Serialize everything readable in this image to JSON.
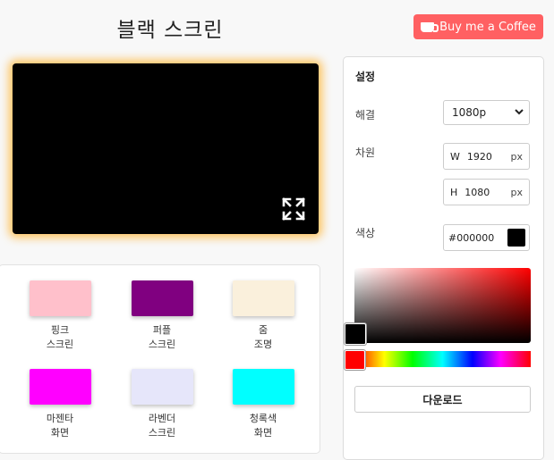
{
  "header": {
    "title": "블랙 스크린",
    "coffee_label": "Buy me a Coffee"
  },
  "screen": {
    "color": "#000000",
    "fullscreen_icon": "expand-icon"
  },
  "swatches": [
    {
      "line1": "핑크",
      "line2": "스크린",
      "color": "#ffc0cb"
    },
    {
      "line1": "퍼플",
      "line2": "스크린",
      "color": "#800080"
    },
    {
      "line1": "줌",
      "line2": "조명",
      "color": "#faf0dc"
    },
    {
      "line1": "마젠타",
      "line2": "화면",
      "color": "#ff00ff"
    },
    {
      "line1": "라벤더",
      "line2": "스크린",
      "color": "#e6e6fa"
    },
    {
      "line1": "청록색",
      "line2": "화면",
      "color": "#00ffff"
    }
  ],
  "settings": {
    "title": "설정",
    "resolution_label": "해결",
    "resolution_value": "1080p",
    "dimension_label": "차원",
    "width_prefix": "W",
    "width_value": "1920",
    "height_prefix": "H",
    "height_value": "1080",
    "unit": "px",
    "color_label": "색상",
    "color_hex": "#000000",
    "download_label": "다운로드"
  }
}
